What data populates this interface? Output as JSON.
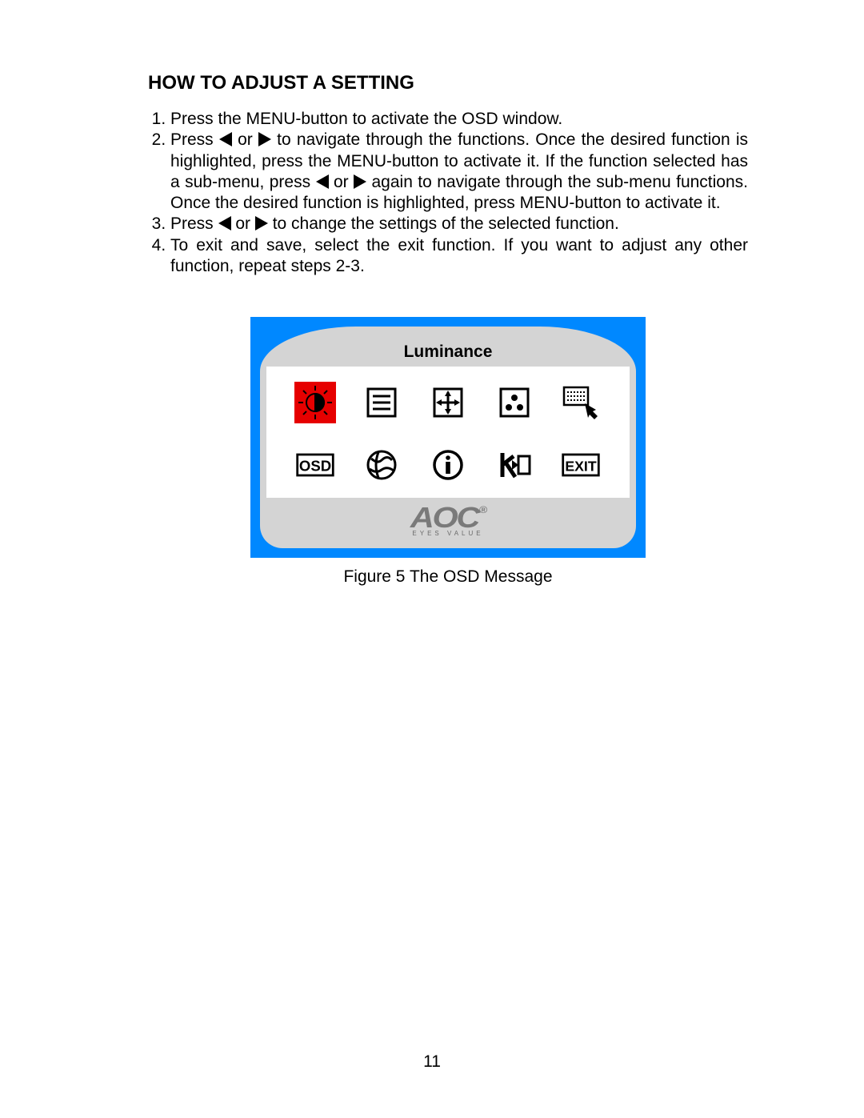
{
  "heading": "HOW TO ADJUST A SETTING",
  "steps": {
    "s1": "Press the MENU-button to activate the OSD window.",
    "s2a": "Press ",
    "s2b": " or ",
    "s2c": " to navigate through the functions. Once the desired function is highlighted, press the MENU-button to activate it. If the function selected has a sub-menu, press ",
    "s2d": " or ",
    "s2e": " again to navigate through the sub-menu functions. Once the desired function is highlighted, press MENU-button to activate it.",
    "s3a": "Press ",
    "s3b": " or ",
    "s3c": " to change the settings of the selected function.",
    "s4": "To exit and save, select the exit function. If you want to adjust any other function, repeat steps 2-3."
  },
  "osd": {
    "title": "Luminance",
    "brand": "AOC",
    "brand_tag": "EYES VALUE",
    "icons": [
      "luminance-icon",
      "image-setup-icon",
      "position-icon",
      "color-icon",
      "auto-adjust-icon",
      "osd-setup-icon",
      "language-icon",
      "information-icon",
      "recall-icon",
      "exit-icon"
    ],
    "selected_index": 0,
    "osd_label": "OSD",
    "exit_label": "EXIT"
  },
  "caption": "Figure 5   The  OSD  Message",
  "page_number": "11"
}
